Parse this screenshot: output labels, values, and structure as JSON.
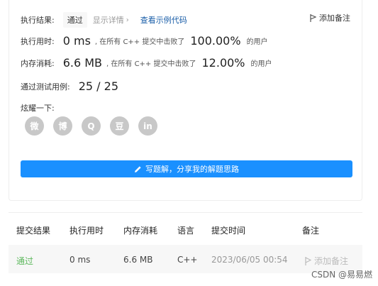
{
  "result": {
    "label": "执行结果:",
    "status": "通过",
    "detail": "显示详情",
    "example_link": "查看示例代码",
    "add_note": "添加备注"
  },
  "runtime": {
    "label": "执行用时:",
    "value": "0 ms",
    "mid_text": ", 在所有 C++ 提交中击败了",
    "pct": "100.00%",
    "tail": "的用户"
  },
  "memory": {
    "label": "内存消耗:",
    "value": "6.6 MB",
    "mid_text": ", 在所有 C++ 提交中击败了",
    "pct": "12.00%",
    "tail": "的用户"
  },
  "tests": {
    "label": "通过测试用例:",
    "value": "25 / 25"
  },
  "share": {
    "label": "炫耀一下:",
    "icons": [
      {
        "name": "wechat-icon",
        "glyph": "微"
      },
      {
        "name": "weibo-icon",
        "glyph": "博"
      },
      {
        "name": "qq-icon",
        "glyph": "Q"
      },
      {
        "name": "douban-icon",
        "glyph": "豆"
      },
      {
        "name": "linkedin-icon",
        "glyph": "in"
      }
    ],
    "button": "写题解，分享我的解题思路"
  },
  "table": {
    "headers": [
      "提交结果",
      "执行用时",
      "内存消耗",
      "语言",
      "提交时间",
      "备注"
    ],
    "rows": [
      {
        "status": "通过",
        "runtime": "0 ms",
        "memory": "6.6 MB",
        "lang": "C++",
        "time": "2023/06/05 00:54",
        "note": "添加备注"
      }
    ]
  },
  "watermark": "CSDN @易易燃",
  "colors": {
    "accent": "#1a90ff",
    "success": "#5cb85c",
    "link": "#1a5ea8"
  }
}
